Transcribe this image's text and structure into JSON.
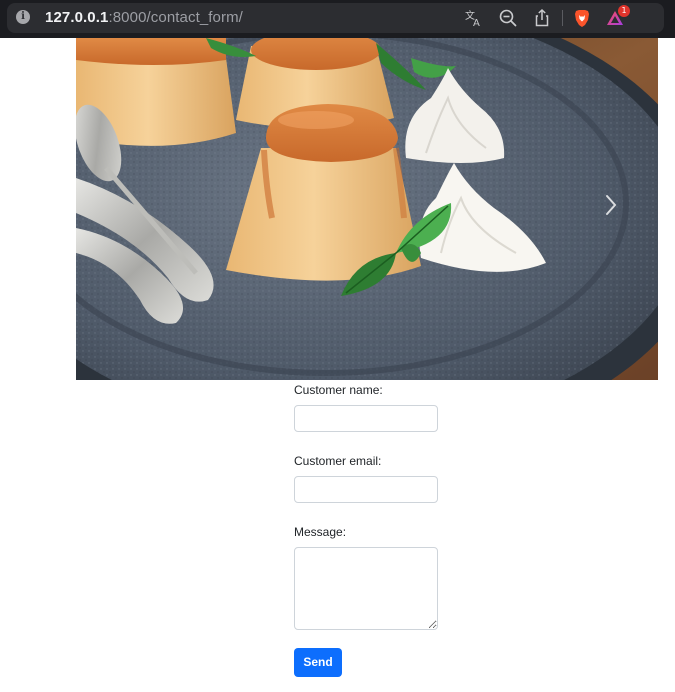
{
  "browser": {
    "url_host": "127.0.0.1",
    "url_rest": ":8000/contact_form/",
    "notification_count": "1"
  },
  "icons": {
    "site_info": "info-icon",
    "translate": "translate-icon",
    "zoom": "zoom-out-icon",
    "share": "share-icon",
    "brave": "brave-lion-icon",
    "rewards": "brave-rewards-icon",
    "carousel_next": "chevron-right-icon"
  },
  "hero": {
    "subject": "flan-dessert-photo"
  },
  "form": {
    "name_label": "Customer name:",
    "email_label": "Customer email:",
    "message_label": "Message:",
    "name_value": "",
    "email_value": "",
    "message_value": "",
    "send_label": "Send"
  },
  "colors": {
    "primary_button": "#0d6efd",
    "topbar": "#1b1c20"
  }
}
